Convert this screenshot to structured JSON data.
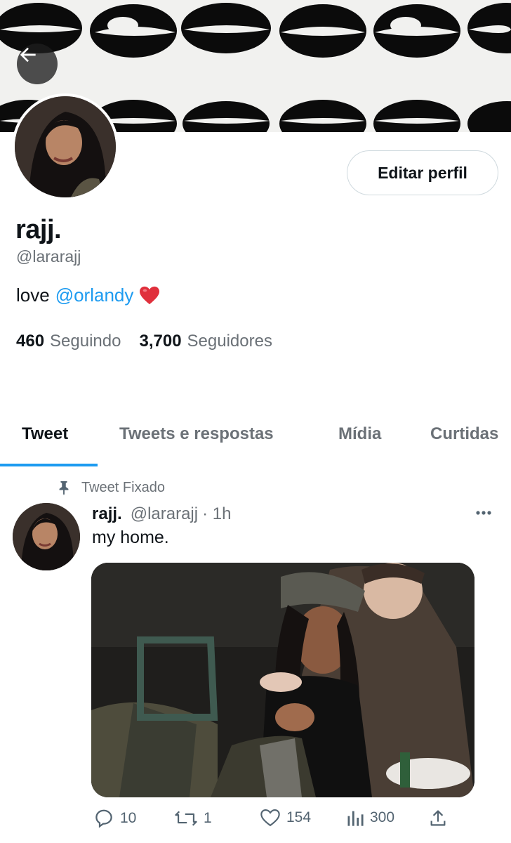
{
  "header": {
    "back_icon": "arrow-left-icon",
    "banner": "black-and-white lips pattern"
  },
  "profile": {
    "edit_button": "Editar perfil",
    "name": "rajj.",
    "handle": "@lararajj",
    "bio_text": "love",
    "bio_mention": "@orlandy",
    "bio_emoji": "heart-emoji",
    "following_count": "460",
    "following_label": "Seguindo",
    "followers_count": "3,700",
    "followers_label": "Seguidores"
  },
  "tabs": [
    {
      "label": "Tweet",
      "active": true
    },
    {
      "label": "Tweets e respostas",
      "active": false
    },
    {
      "label": "Mídia",
      "active": false
    },
    {
      "label": "Curtidas",
      "active": false
    }
  ],
  "pinned": {
    "label": "Tweet Fixado",
    "icon": "pin-icon"
  },
  "tweet": {
    "name": "rajj.",
    "handle": "@lararajj",
    "time": "· 1h",
    "text": "my home.",
    "more_icon": "more-horizontal-icon",
    "actions": {
      "replies": "10",
      "retweets": "1",
      "likes": "154",
      "views": "300"
    }
  },
  "colors": {
    "accent": "#1d9bf0",
    "secondary_text": "#6b7177",
    "primary_text": "#0f1419"
  }
}
